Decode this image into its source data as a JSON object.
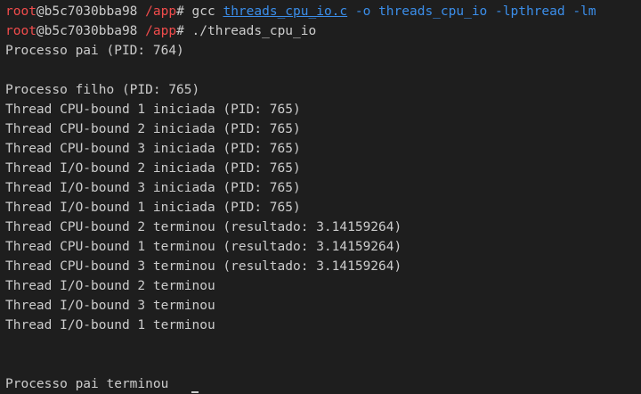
{
  "colors": {
    "background": "#1e1e1e",
    "text": "#cccccc",
    "prompt_user": "#f14c4c",
    "command_args": "#3b8eea"
  },
  "prompt": {
    "user": "root",
    "host": "@b5c7030bba98",
    "path": " /app",
    "symbol": "# "
  },
  "commands": [
    {
      "name": "gcc ",
      "args": [
        {
          "text": "threads_cpu_io.c",
          "underlined": true
        },
        {
          "text": " -o threads_cpu_io -lpthread -lm",
          "underlined": false
        }
      ]
    },
    {
      "name": "./threads_cpu_io",
      "args": []
    }
  ],
  "output": [
    "Processo pai (PID: 764)",
    "",
    "Processo filho (PID: 765)",
    "Thread CPU-bound 1 iniciada (PID: 765)",
    "Thread CPU-bound 2 iniciada (PID: 765)",
    "Thread CPU-bound 3 iniciada (PID: 765)",
    "Thread I/O-bound 2 iniciada (PID: 765)",
    "Thread I/O-bound 3 iniciada (PID: 765)",
    "Thread I/O-bound 1 iniciada (PID: 765)",
    "Thread CPU-bound 2 terminou (resultado: 3.14159264)",
    "Thread CPU-bound 1 terminou (resultado: 3.14159264)",
    "Thread CPU-bound 3 terminou (resultado: 3.14159264)",
    "Thread I/O-bound 2 terminou",
    "Thread I/O-bound 3 terminou",
    "Thread I/O-bound 1 terminou",
    "",
    "",
    "Processo pai terminou"
  ]
}
